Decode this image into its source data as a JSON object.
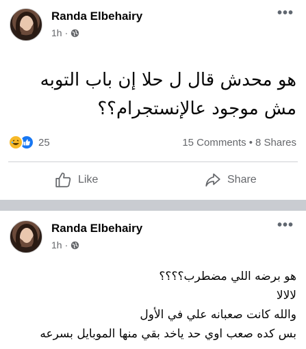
{
  "posts": [
    {
      "author": "Randa Elbehairy",
      "time": "1h",
      "dot": "·",
      "more": "•••",
      "text_lines": [
        "هو محدش قال ل حلا إن باب التوبه",
        "مش موجود عالإنستجرام؟؟"
      ],
      "reaction_count": "25",
      "comments": "15 Comments",
      "stats_sep": "•",
      "shares": "8 Shares",
      "like_label": "Like",
      "share_label": "Share"
    },
    {
      "author": "Randa Elbehairy",
      "time": "1h",
      "dot": "·",
      "more": "•••",
      "text_lines": [
        "هو برضه اللي مضطرب؟؟؟؟",
        "لالالا",
        "والله كانت صعبانه علي في الأول",
        "بس كده صعب اوي حد ياخد بقي منها الموبايل بسرعه"
      ]
    }
  ],
  "colors": {
    "secondary_text": "#65676b",
    "like_blue": "#1877f2",
    "haha_yellow": "#f7b928",
    "separator": "#c9ccd1"
  },
  "icons": {
    "privacy": "globe-icon",
    "more": "more-dots-icon",
    "like": "thumbs-up-icon",
    "share": "share-arrow-icon",
    "reaction_haha": "haha-reaction-icon",
    "reaction_like": "like-reaction-icon"
  }
}
